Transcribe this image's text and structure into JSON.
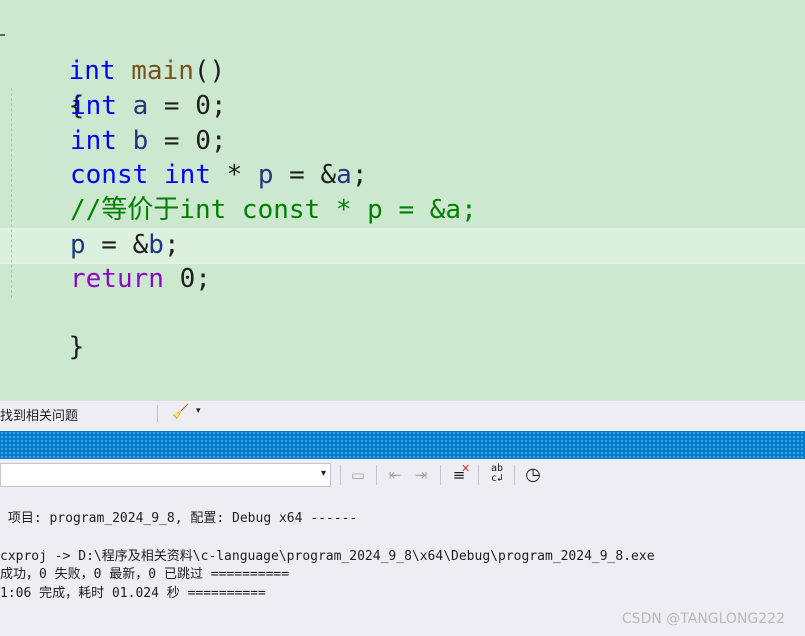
{
  "editor": {
    "line1": {
      "kw": "int",
      "fn": "main",
      "punct": "()"
    },
    "line2": {
      "brace": "{"
    },
    "line3": {
      "kw": "int",
      "var": "a",
      "rest": " = 0;"
    },
    "line4": {
      "kw": "int",
      "var": "b",
      "rest": " = 0;"
    },
    "line5": {
      "kw1": "const",
      "kw2": "int",
      "mid": " * ",
      "var": "p",
      "eq": " = &",
      "var2": "a",
      "end": ";"
    },
    "line6": {
      "comment": "//等价于int const * p = &a;"
    },
    "line7": {
      "var": "p",
      "eq": " = &",
      "var2": "b",
      "end": ";"
    },
    "line8": {
      "kw": "return",
      "rest": " 0;"
    },
    "line9": {
      "brace": "}"
    }
  },
  "status_strip": {
    "issues_text": "找到相关问题",
    "brush_icon": "broom-icon",
    "brush_caret": "▾"
  },
  "toolbar": {
    "combo_caret": "▾",
    "icons": {
      "a": "▭",
      "b": "⇤",
      "c": "⇥",
      "d": "✕",
      "e": "↲",
      "f": "◷"
    }
  },
  "output": {
    "line1": " 项目: program_2024_9_8, 配置: Debug x64 ------",
    "line2": "cxproj -> D:\\程序及相关资料\\c-language\\program_2024_9_8\\x64\\Debug\\program_2024_9_8.exe",
    "line3": "成功，0 失败，0 最新，0 已跳过 ==========",
    "line4": "1:06 完成，耗时 01.024 秒 =========="
  },
  "watermark": "CSDN @TANGLONG222"
}
